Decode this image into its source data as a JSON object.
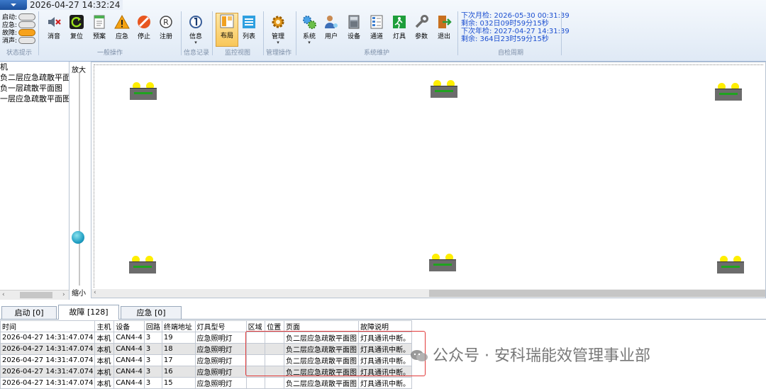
{
  "header": {
    "datetime": "2026-04-27 14:32:24"
  },
  "status": {
    "caption": "状态提示",
    "rows": [
      {
        "label": "启动:",
        "color": "#e6e6e6"
      },
      {
        "label": "应急:",
        "color": "#e6e6e6"
      },
      {
        "label": "故障:",
        "color": "#f7a21b"
      },
      {
        "label": "消声:",
        "color": "#e6e6e6"
      }
    ]
  },
  "groups": {
    "general": "一般操作",
    "info": "信息记录",
    "monitor": "监控视图",
    "manage": "管理操作",
    "system": "系统维护",
    "cycle": "自检周期"
  },
  "toolbar": {
    "mute": "消音",
    "reset": "复位",
    "plan": "预案",
    "emergency": "应急",
    "stop": "停止",
    "register": "注册",
    "info": "信息",
    "layout": "布局",
    "list": "列表",
    "manage": "管理",
    "system": "系统",
    "user": "用户",
    "device": "设备",
    "channel": "通道",
    "lamp": "灯具",
    "params": "参数",
    "exit": "退出",
    "dropdown": "▾"
  },
  "cycle": {
    "monthly_next": "下次月检: 2026-05-30 00:31:39",
    "monthly_left": "剩余: 032日09时59分15秒",
    "yearly_next": "下次年检: 2027-04-27 14:31:39",
    "yearly_left": "剩余: 364日23时59分15秒"
  },
  "tree": {
    "items": [
      "机",
      "负二层应急疏散平面",
      "负一层疏散平面图",
      "一层应急疏散平面图"
    ],
    "left_arrow": "‹",
    "right_arrow": "›"
  },
  "zoom": {
    "in": "放大",
    "out": "缩小"
  },
  "canvas": {
    "lamp_count": 6,
    "scroll_arrow": "‹"
  },
  "tabs": [
    {
      "label": "启动 [0]",
      "active": false
    },
    {
      "label": "故障 [128]",
      "active": true
    },
    {
      "label": "应急 [0]",
      "active": false
    }
  ],
  "table": {
    "columns": [
      "时间",
      "主机",
      "设备",
      "回路",
      "终端地址",
      "灯具型号",
      "区域",
      "位置",
      "页面",
      "故障说明"
    ],
    "rows": [
      [
        "2026-04-27 14:31:47.074",
        "本机",
        "CAN4-4",
        "3",
        "19",
        "应急照明灯",
        "",
        "",
        "负二层应急疏散平面图",
        "灯具通讯中断。"
      ],
      [
        "2026-04-27 14:31:47.074",
        "本机",
        "CAN4-4",
        "3",
        "18",
        "应急照明灯",
        "",
        "",
        "负二层应急疏散平面图",
        "灯具通讯中断。"
      ],
      [
        "2026-04-27 14:31:47.074",
        "本机",
        "CAN4-4",
        "3",
        "17",
        "应急照明灯",
        "",
        "",
        "负二层应急疏散平面图",
        "灯具通讯中断。"
      ],
      [
        "2026-04-27 14:31:47.074",
        "本机",
        "CAN4-4",
        "3",
        "16",
        "应急照明灯",
        "",
        "",
        "负二层应急疏散平面图",
        "灯具通讯中断。"
      ],
      [
        "2026-04-27 14:31:47.074",
        "本机",
        "CAN4-4",
        "3",
        "15",
        "应急照明灯",
        "",
        "",
        "负二层应急疏散平面图",
        "灯具通讯中断。"
      ]
    ]
  },
  "watermark": {
    "text": "公众号 · 安科瑞能效管理事业部"
  }
}
